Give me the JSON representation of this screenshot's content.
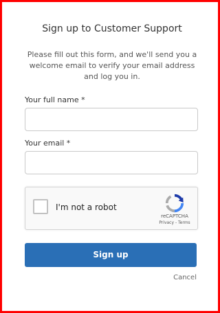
{
  "form": {
    "title": "Sign up to Customer Support",
    "intro": "Please fill out this form, and we'll send you a welcome email to verify your email address and log you in.",
    "full_name_label": "Your full name *",
    "full_name_value": "",
    "email_label": "Your email *",
    "email_value": "",
    "signup_label": "Sign up",
    "cancel_label": "Cancel"
  },
  "captcha": {
    "label": "I'm not a robot",
    "brand": "reCAPTCHA",
    "links": "Privacy - Terms",
    "logo_icon": "recaptcha-logo"
  },
  "colors": {
    "frame_border": "#ff0000",
    "button_bg": "#2a6fb6",
    "button_text": "#ffffff"
  }
}
